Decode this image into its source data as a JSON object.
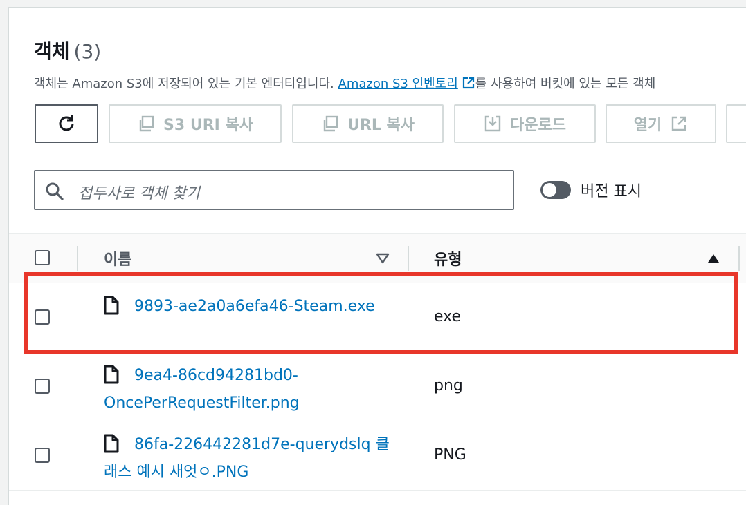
{
  "header": {
    "title": "객체",
    "count": "(3)",
    "description_prefix": "객체는 Amazon S3에 저장되어 있는 기본 엔터티입니다.",
    "description_link": "Amazon S3 인벤토리",
    "description_suffix": "를 사용하여 버킷에 있는 모든 객체"
  },
  "toolbar": {
    "refresh_icon": "refresh-icon",
    "copy_s3_uri_label": "S3 URI 복사",
    "copy_url_label": "URL 복사",
    "download_label": "다운로드",
    "open_label": "열기"
  },
  "search": {
    "placeholder": "접두사로 객체 찾기"
  },
  "versions_toggle": {
    "label": "버전 표시",
    "on": false
  },
  "table": {
    "columns": {
      "name": "이름",
      "type": "유형"
    },
    "rows": [
      {
        "name": "9893-ae2a0a6efa46-Steam.exe",
        "type": "exe",
        "highlighted": true
      },
      {
        "name": "9ea4-86cd94281bd0-OncePerRequestFilter.png",
        "type": "png"
      },
      {
        "name": "86fa-226442281d7e-querydslq 클래스 예시 새엇ㅇ.PNG",
        "type": "PNG"
      }
    ]
  },
  "colors": {
    "link": "#0073bb",
    "highlight": "#e8362a",
    "disabled_text": "#aab7b8"
  }
}
